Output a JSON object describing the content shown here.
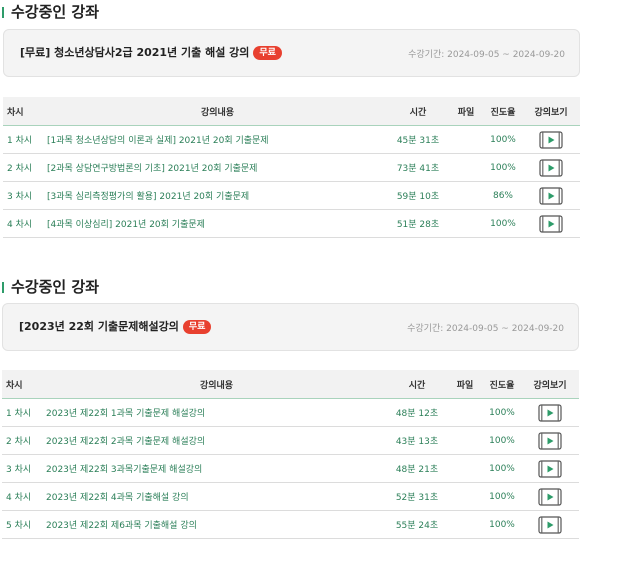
{
  "sections": [
    {
      "title": "수강중인 강좌",
      "course_name": "[무료] 청소년상담사2급 2021년 기출 해설 강의",
      "badge": "무료",
      "period": "수강기간: 2024-09-05 ~ 2024-09-20",
      "headers": {
        "no": "차시",
        "title": "강의내용",
        "time": "시간",
        "file": "파일",
        "progress": "진도율",
        "view": "강의보기"
      },
      "rows": [
        {
          "no": "1 차시",
          "title": "[1과목 청소년상담의 이론과 실제] 2021년 20회 기출문제",
          "time": "45분 31초",
          "progress": "100%"
        },
        {
          "no": "2 차시",
          "title": "[2과목 상담연구방법론의 기초] 2021년 20회 기출문제",
          "time": "73분 41초",
          "progress": "100%"
        },
        {
          "no": "3 차시",
          "title": "[3과목 심리측정평가의 활용] 2021년 20회 기출문제",
          "time": "59분 10초",
          "progress": "86%"
        },
        {
          "no": "4 차시",
          "title": "[4과목 이상심리] 2021년 20회 기출문제",
          "time": "51분 28초",
          "progress": "100%"
        }
      ]
    },
    {
      "title": "수강중인 강좌",
      "course_name": "[2023년 22회 기출문제해설강의",
      "badge": "무료",
      "period": "수강기간: 2024-09-05 ~ 2024-09-20",
      "headers": {
        "no": "차시",
        "title": "강의내용",
        "time": "시간",
        "file": "파일",
        "progress": "진도율",
        "view": "강의보기"
      },
      "rows": [
        {
          "no": "1 차시",
          "title": "2023년 제22회 1과목 기출문제 해설강의",
          "time": "48분 12초",
          "progress": "100%"
        },
        {
          "no": "2 차시",
          "title": "2023년 제22회 2과목 기출문제 해설강의",
          "time": "43분 13초",
          "progress": "100%"
        },
        {
          "no": "3 차시",
          "title": "2023년 제22회 3과목기출문제 해설강의",
          "time": "48분 21초",
          "progress": "100%"
        },
        {
          "no": "4 차시",
          "title": "2023년 제22회 4과목 기출해설 강의",
          "time": "52분 31초",
          "progress": "100%"
        },
        {
          "no": "5 차시",
          "title": "2023년 제22회 제6과목 기출해설 강의",
          "time": "55분 24초",
          "progress": "100%"
        }
      ]
    }
  ],
  "icons": {
    "view": "video-play-icon"
  },
  "colors": {
    "accent": "#2e9c6a",
    "badge": "#e8402f",
    "row_text": "#2b7f58"
  }
}
